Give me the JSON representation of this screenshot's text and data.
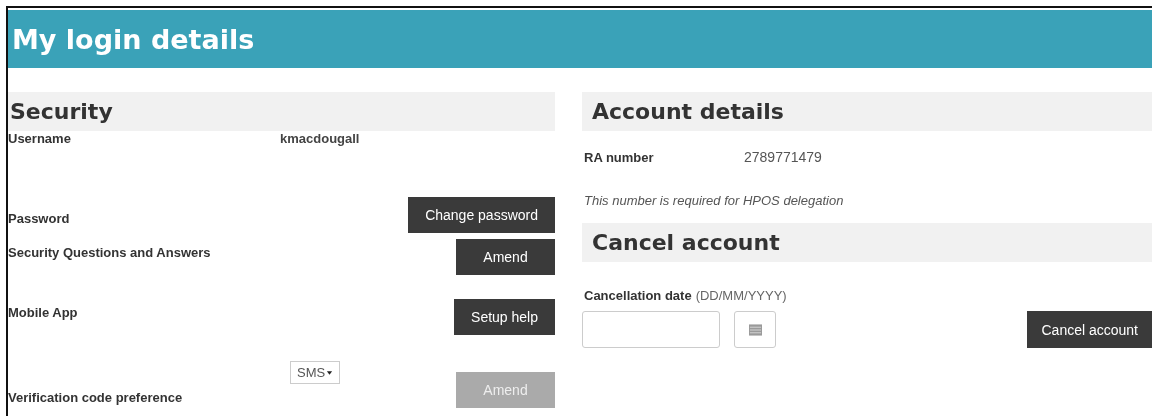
{
  "header": {
    "title": "My login details"
  },
  "security": {
    "heading": "Security",
    "rows": [
      {
        "kind": "value",
        "label": "Username",
        "value": "kmacdougall"
      },
      {
        "kind": "button",
        "label": "Password",
        "button": {
          "label": "Change password",
          "disabled": false
        }
      },
      {
        "kind": "button",
        "label": "Security Questions and Answers",
        "button": {
          "label": "Amend",
          "disabled": false
        }
      },
      {
        "kind": "button",
        "label": "Mobile App",
        "button": {
          "label": "Setup help",
          "disabled": false
        }
      },
      {
        "kind": "select",
        "label": "Verification code preference",
        "select": "SMS",
        "button": {
          "label": "Amend",
          "disabled": true
        }
      }
    ]
  },
  "account": {
    "heading": "Account details",
    "ra_label": "RA number",
    "ra_value": "2789771479",
    "note": "This number is required for HPOS delegation"
  },
  "cancel": {
    "heading": "Cancel account",
    "date_label": "Cancellation date",
    "date_hint": "(DD/MM/YYYY)",
    "button": {
      "label": "Cancel account",
      "disabled": false
    }
  }
}
